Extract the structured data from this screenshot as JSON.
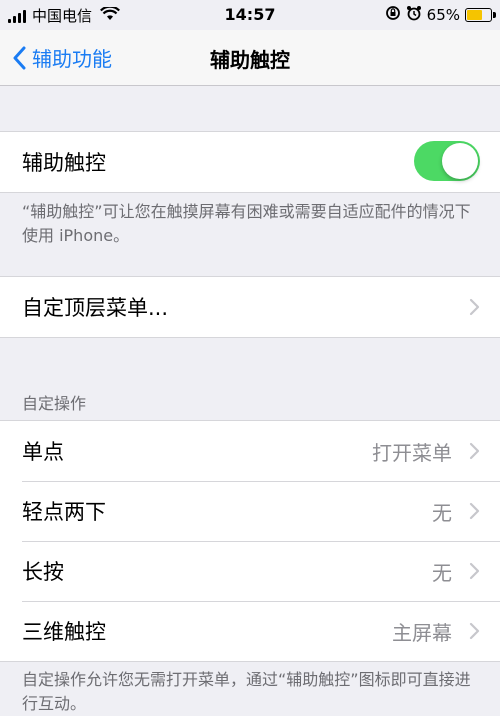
{
  "status_bar": {
    "carrier": "中国电信",
    "time": "14:57",
    "battery_percent": "65%",
    "battery_color": "#f5c400"
  },
  "nav": {
    "back_label": "辅助功能",
    "title": "辅助触控"
  },
  "assistive_touch": {
    "label": "辅助触控",
    "enabled": true,
    "toggle_color": "#4cd964",
    "footnote": "“辅助触控”可让您在触摸屏幕有困难或需要自适应配件的情况下使用 iPhone。"
  },
  "top_menu": {
    "label": "自定顶层菜单..."
  },
  "custom_actions": {
    "header": "自定操作",
    "rows": [
      {
        "label": "单点",
        "value": "打开菜单"
      },
      {
        "label": "轻点两下",
        "value": "无"
      },
      {
        "label": "长按",
        "value": "无"
      },
      {
        "label": "三维触控",
        "value": "主屏幕"
      }
    ],
    "footnote": "自定操作允许您无需打开菜单，通过“辅助触控”图标即可直接进行互动。"
  },
  "accent_color": "#1a7cf3"
}
